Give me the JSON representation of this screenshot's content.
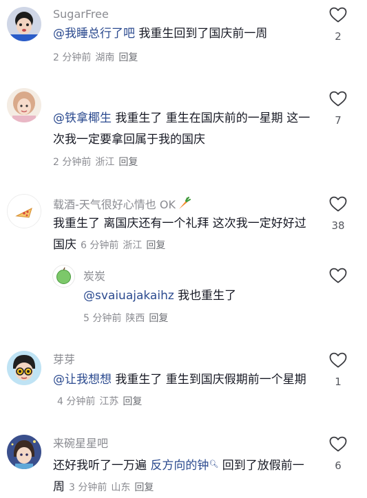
{
  "comments": [
    {
      "username": "SugarFree",
      "mention": "@我睡总行了吧",
      "text": " 我重生回到了国庆前一周",
      "time": "2 分钟前",
      "location": "湖南",
      "reply": "回复",
      "likes": "2"
    },
    {
      "username": "",
      "mention": "@铁拿椰生",
      "text": " 我重生了 重生在国庆前的一星期 这一次我一定要拿回属于我的国庆",
      "time": "2 分钟前",
      "location": "浙江",
      "reply": "回复",
      "likes": "7"
    },
    {
      "username": "载酒-天气很好心情也 OK",
      "text": "我重生了 离国庆还有一个礼拜 这次我一定好好过国庆",
      "time": "6 分钟前",
      "location": "浙江",
      "reply": "回复",
      "likes": "38"
    },
    {
      "username": "炭炭",
      "mention": "@svaiuajakaihz",
      "text": " 我也重生了",
      "time": "5 分钟前",
      "location": "陕西",
      "reply": "回复"
    },
    {
      "username": "芽芽",
      "mention": "@让我想想",
      "text": " 我重生了 重生到国庆假期前一个星期",
      "time": "4 分钟前",
      "location": "江苏",
      "reply": "回复",
      "likes": "1"
    },
    {
      "username": "来碗星星吧",
      "text_before": "还好我听了一万遍 ",
      "link": "反方向的钟",
      "text_after": " 回到了放假前一周",
      "time": "3 分钟前",
      "location": "山东",
      "reply": "回复",
      "likes": "6"
    }
  ],
  "colors": {
    "username": "#8a8b91",
    "mention": "#2b4a8f",
    "body": "#161823",
    "meta": "#8a8b91"
  },
  "icons": {
    "like": "heart-outline-icon",
    "link_search": "search-icon",
    "emoji": "carrot-emoji"
  }
}
